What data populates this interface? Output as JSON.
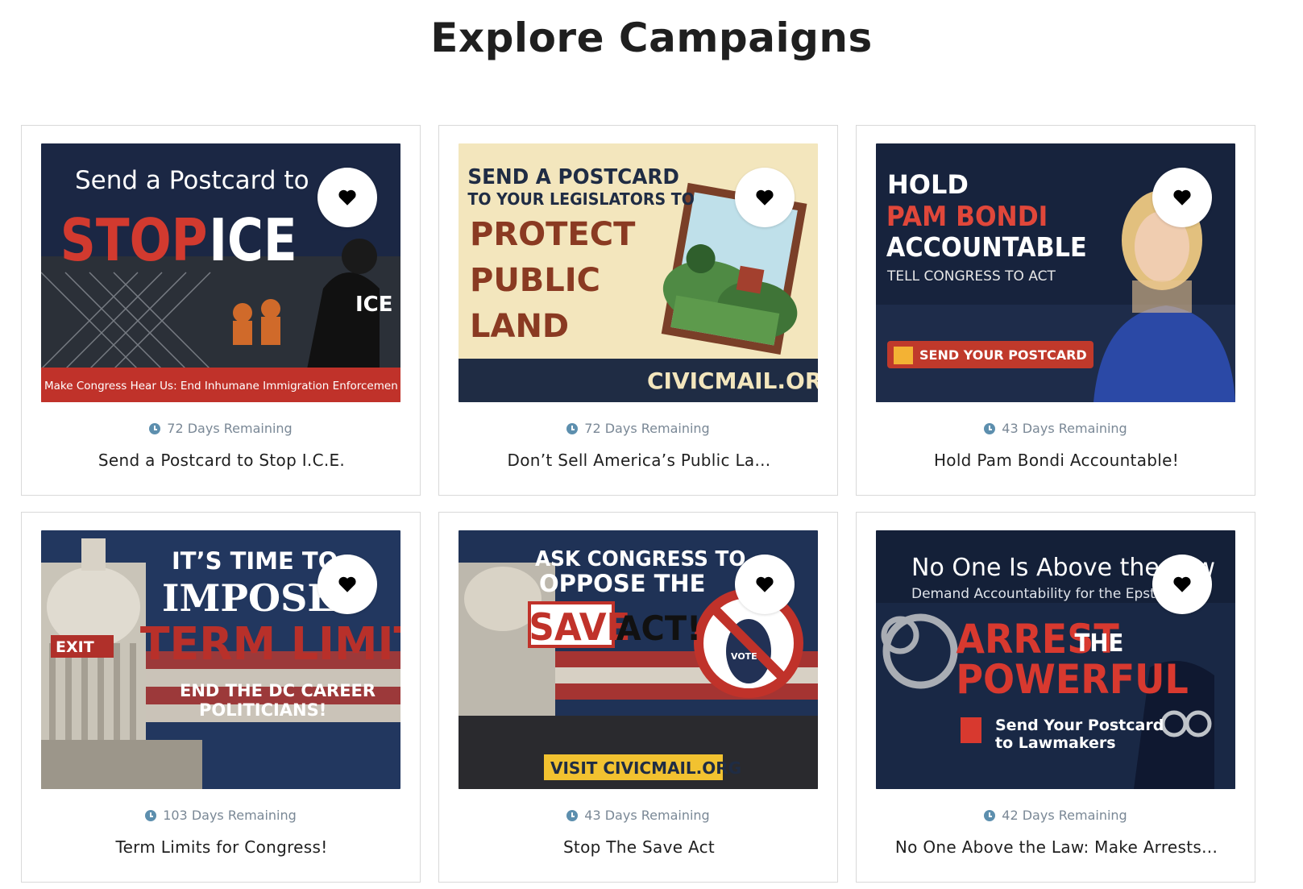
{
  "page": {
    "title": "Explore Campaigns"
  },
  "campaigns": [
    {
      "days": "72 Days Remaining",
      "title": "Send a Postcard to Stop I.C.E.",
      "image_text": {
        "line1": "Send a Postcard to",
        "stop": "STOP",
        "ice": "ICE",
        "badge": "ICE",
        "banner": "Make Congress Hear Us: End Inhumane Immigration Enforcemen"
      }
    },
    {
      "days": "72 Days Remaining",
      "title": "Don’t Sell America’s Public La...",
      "image_text": {
        "line1": "SEND A POSTCARD",
        "line2": "TO YOUR LEGISLATORS TO",
        "w1": "PROTECT",
        "w2": "PUBLIC",
        "w3": "LAND",
        "site": "CIVICMAIL.ORG"
      }
    },
    {
      "days": "43 Days Remaining",
      "title": "Hold Pam Bondi Accountable!",
      "image_text": {
        "l1": "HOLD",
        "l2": "PAM BONDI",
        "l3": "ACCOUNTABLE",
        "l4": "TELL CONGRESS TO ACT",
        "cta": "SEND YOUR POSTCARD"
      }
    },
    {
      "days": "103 Days Remaining",
      "title": "Term Limits for Congress!",
      "image_text": {
        "l1": "IT’S TIME TO",
        "l2": "IMPOSE",
        "l3": "TERM LIMITS",
        "l4": "END THE DC CAREER",
        "l5": "POLITICIANS!",
        "exit": "EXIT"
      }
    },
    {
      "days": "43 Days Remaining",
      "title": "Stop The Save Act",
      "image_text": {
        "l1": "ASK CONGRESS TO",
        "l2": "OPPOSE THE",
        "save": "SAVE",
        "act": "ACT!",
        "vote": "VOTE",
        "site": "VISIT CIVICMAIL.ORG"
      }
    },
    {
      "days": "42 Days Remaining",
      "title": "No One Above the Law: Make Arrests...",
      "image_text": {
        "l1": "No One Is Above the Law",
        "l2": "Demand Accountability for the Epstein",
        "l3": "ARREST",
        "l3b": "THE",
        "l4": "POWERFUL",
        "l5": "Send Your Postcard",
        "l6": "to Lawmakers"
      }
    }
  ],
  "colors": {
    "accent_red": "#c8352b",
    "navy": "#1b2a48",
    "clock_blue": "#5d8fae"
  },
  "icons": {
    "favorite": "heart-icon",
    "days": "clock-icon"
  }
}
